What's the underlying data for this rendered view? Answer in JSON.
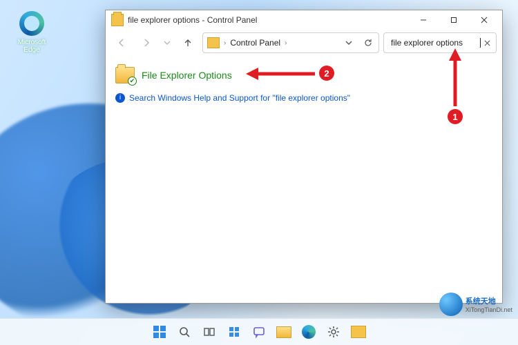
{
  "desktop": {
    "edge_label": "Microsoft\nEdge"
  },
  "window": {
    "title": "file explorer options - Control Panel",
    "controls": {
      "min": "—",
      "max": "▢",
      "close": "✕"
    }
  },
  "nav": {
    "back": "←",
    "forward": "→",
    "recent_dropdown": "⌄",
    "up": "↑"
  },
  "address": {
    "root_icon": "control-panel-icon",
    "segments": [
      "Control Panel"
    ],
    "dropdown": "⌄",
    "refresh": "⟳"
  },
  "search": {
    "value": "file explorer options",
    "clear": "✕"
  },
  "results": {
    "primary_label": "File Explorer Options",
    "help_text": "Search Windows Help and Support for \"file explorer options\""
  },
  "annotations": {
    "step1": "1",
    "step2": "2"
  },
  "watermark": {
    "line1": "系统天地",
    "line2": "XiTongTianDi.net"
  }
}
